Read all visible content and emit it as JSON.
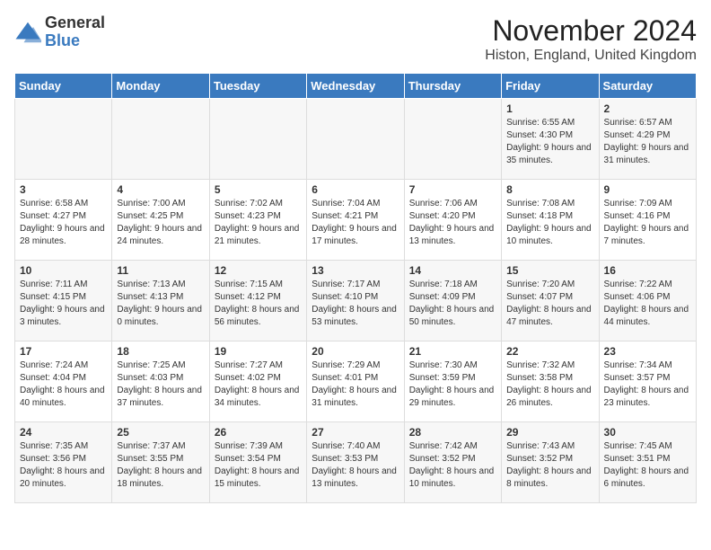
{
  "logo": {
    "text_general": "General",
    "text_blue": "Blue"
  },
  "title": "November 2024",
  "subtitle": "Histon, England, United Kingdom",
  "days_of_week": [
    "Sunday",
    "Monday",
    "Tuesday",
    "Wednesday",
    "Thursday",
    "Friday",
    "Saturday"
  ],
  "weeks": [
    [
      {
        "day": "",
        "info": ""
      },
      {
        "day": "",
        "info": ""
      },
      {
        "day": "",
        "info": ""
      },
      {
        "day": "",
        "info": ""
      },
      {
        "day": "",
        "info": ""
      },
      {
        "day": "1",
        "info": "Sunrise: 6:55 AM\nSunset: 4:30 PM\nDaylight: 9 hours and 35 minutes."
      },
      {
        "day": "2",
        "info": "Sunrise: 6:57 AM\nSunset: 4:29 PM\nDaylight: 9 hours and 31 minutes."
      }
    ],
    [
      {
        "day": "3",
        "info": "Sunrise: 6:58 AM\nSunset: 4:27 PM\nDaylight: 9 hours and 28 minutes."
      },
      {
        "day": "4",
        "info": "Sunrise: 7:00 AM\nSunset: 4:25 PM\nDaylight: 9 hours and 24 minutes."
      },
      {
        "day": "5",
        "info": "Sunrise: 7:02 AM\nSunset: 4:23 PM\nDaylight: 9 hours and 21 minutes."
      },
      {
        "day": "6",
        "info": "Sunrise: 7:04 AM\nSunset: 4:21 PM\nDaylight: 9 hours and 17 minutes."
      },
      {
        "day": "7",
        "info": "Sunrise: 7:06 AM\nSunset: 4:20 PM\nDaylight: 9 hours and 13 minutes."
      },
      {
        "day": "8",
        "info": "Sunrise: 7:08 AM\nSunset: 4:18 PM\nDaylight: 9 hours and 10 minutes."
      },
      {
        "day": "9",
        "info": "Sunrise: 7:09 AM\nSunset: 4:16 PM\nDaylight: 9 hours and 7 minutes."
      }
    ],
    [
      {
        "day": "10",
        "info": "Sunrise: 7:11 AM\nSunset: 4:15 PM\nDaylight: 9 hours and 3 minutes."
      },
      {
        "day": "11",
        "info": "Sunrise: 7:13 AM\nSunset: 4:13 PM\nDaylight: 9 hours and 0 minutes."
      },
      {
        "day": "12",
        "info": "Sunrise: 7:15 AM\nSunset: 4:12 PM\nDaylight: 8 hours and 56 minutes."
      },
      {
        "day": "13",
        "info": "Sunrise: 7:17 AM\nSunset: 4:10 PM\nDaylight: 8 hours and 53 minutes."
      },
      {
        "day": "14",
        "info": "Sunrise: 7:18 AM\nSunset: 4:09 PM\nDaylight: 8 hours and 50 minutes."
      },
      {
        "day": "15",
        "info": "Sunrise: 7:20 AM\nSunset: 4:07 PM\nDaylight: 8 hours and 47 minutes."
      },
      {
        "day": "16",
        "info": "Sunrise: 7:22 AM\nSunset: 4:06 PM\nDaylight: 8 hours and 44 minutes."
      }
    ],
    [
      {
        "day": "17",
        "info": "Sunrise: 7:24 AM\nSunset: 4:04 PM\nDaylight: 8 hours and 40 minutes."
      },
      {
        "day": "18",
        "info": "Sunrise: 7:25 AM\nSunset: 4:03 PM\nDaylight: 8 hours and 37 minutes."
      },
      {
        "day": "19",
        "info": "Sunrise: 7:27 AM\nSunset: 4:02 PM\nDaylight: 8 hours and 34 minutes."
      },
      {
        "day": "20",
        "info": "Sunrise: 7:29 AM\nSunset: 4:01 PM\nDaylight: 8 hours and 31 minutes."
      },
      {
        "day": "21",
        "info": "Sunrise: 7:30 AM\nSunset: 3:59 PM\nDaylight: 8 hours and 29 minutes."
      },
      {
        "day": "22",
        "info": "Sunrise: 7:32 AM\nSunset: 3:58 PM\nDaylight: 8 hours and 26 minutes."
      },
      {
        "day": "23",
        "info": "Sunrise: 7:34 AM\nSunset: 3:57 PM\nDaylight: 8 hours and 23 minutes."
      }
    ],
    [
      {
        "day": "24",
        "info": "Sunrise: 7:35 AM\nSunset: 3:56 PM\nDaylight: 8 hours and 20 minutes."
      },
      {
        "day": "25",
        "info": "Sunrise: 7:37 AM\nSunset: 3:55 PM\nDaylight: 8 hours and 18 minutes."
      },
      {
        "day": "26",
        "info": "Sunrise: 7:39 AM\nSunset: 3:54 PM\nDaylight: 8 hours and 15 minutes."
      },
      {
        "day": "27",
        "info": "Sunrise: 7:40 AM\nSunset: 3:53 PM\nDaylight: 8 hours and 13 minutes."
      },
      {
        "day": "28",
        "info": "Sunrise: 7:42 AM\nSunset: 3:52 PM\nDaylight: 8 hours and 10 minutes."
      },
      {
        "day": "29",
        "info": "Sunrise: 7:43 AM\nSunset: 3:52 PM\nDaylight: 8 hours and 8 minutes."
      },
      {
        "day": "30",
        "info": "Sunrise: 7:45 AM\nSunset: 3:51 PM\nDaylight: 8 hours and 6 minutes."
      }
    ]
  ]
}
